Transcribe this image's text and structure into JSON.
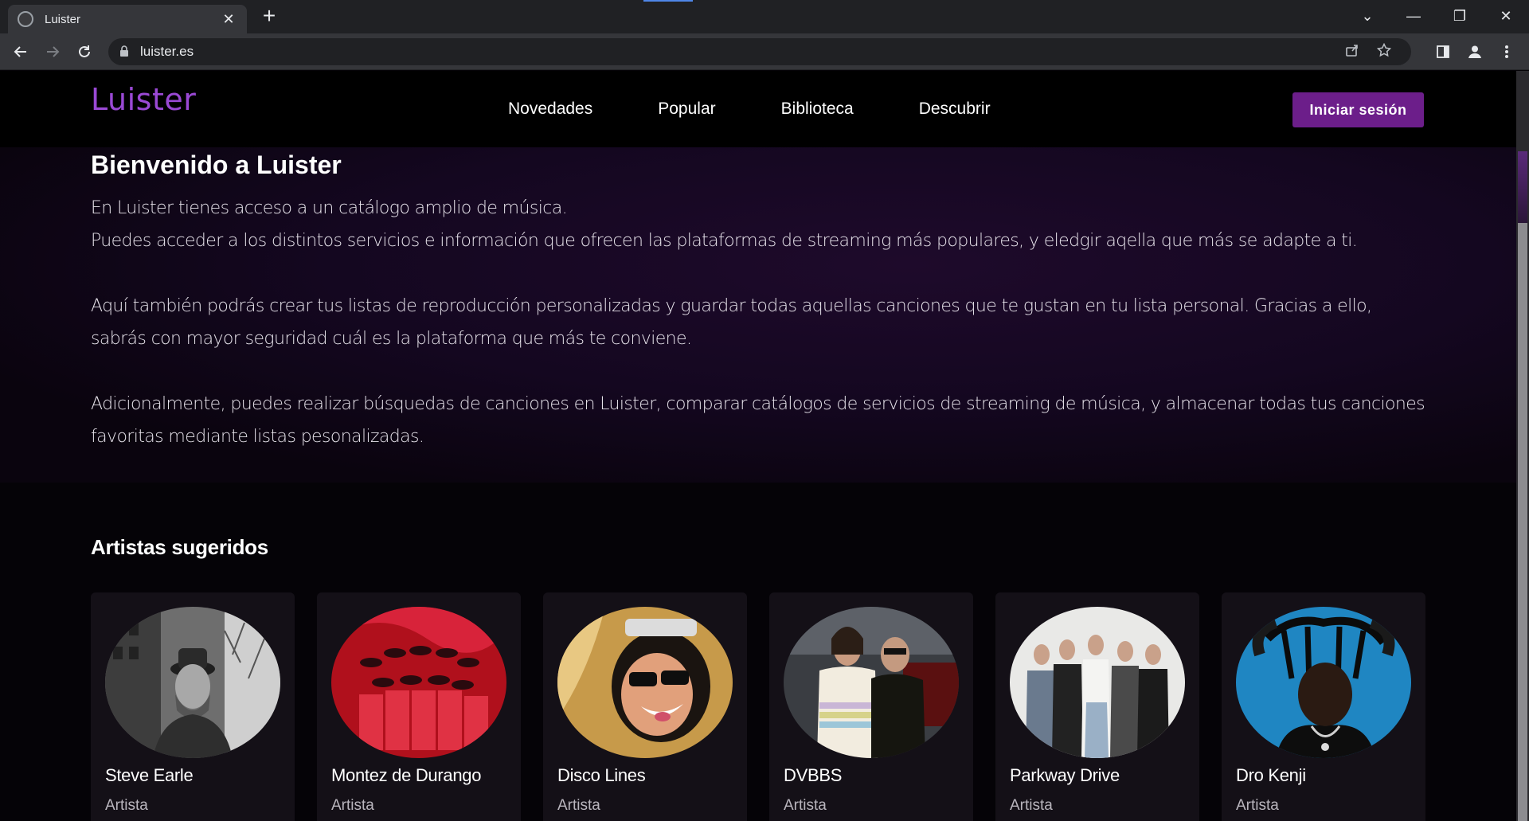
{
  "browser": {
    "tab_title": "Luister",
    "tab_close": "✕",
    "new_tab": "+",
    "url": "luister.es",
    "window_controls": {
      "dropdown": "⌄",
      "minimize": "—",
      "restore": "❐",
      "close": "✕"
    }
  },
  "site": {
    "logo": "Luister",
    "nav": [
      "Novedades",
      "Popular",
      "Biblioteca",
      "Descubrir"
    ],
    "login_label": "Iniciar sesión"
  },
  "welcome": {
    "title": "Bienvenido a Luister",
    "paragraph_1a": "En Luister tienes acceso a un catálogo amplio de música.",
    "paragraph_1b": "Puedes acceder a los distintos servicios e información que ofrecen las plataformas de streaming más populares, y eledgir aqella que más se adapte a ti.",
    "paragraph_2": "Aquí también podrás crear tus listas de reproducción personalizadas y guardar todas aquellas canciones que te gustan en tu lista personal. Gracias a ello, sabrás con mayor seguridad cuál es la plataforma que más te conviene.",
    "paragraph_3": "Adicionalmente, puedes realizar búsquedas de canciones en Luister, comparar catálogos de servicios de streaming de música, y almacenar todas tus canciones favoritas mediante listas pesonalizadas."
  },
  "suggested": {
    "title": "Artistas sugeridos",
    "artists": [
      {
        "name": "Steve Earle",
        "role": "Artista"
      },
      {
        "name": "Montez de Durango",
        "role": "Artista"
      },
      {
        "name": "Disco Lines",
        "role": "Artista"
      },
      {
        "name": "DVBBS",
        "role": "Artista"
      },
      {
        "name": "Parkway Drive",
        "role": "Artista"
      },
      {
        "name": "Dro Kenji",
        "role": "Artista"
      }
    ]
  },
  "colors": {
    "brand_purple": "#9a49d4",
    "button_purple": "#6c1e8a",
    "page_background": "#050307"
  }
}
